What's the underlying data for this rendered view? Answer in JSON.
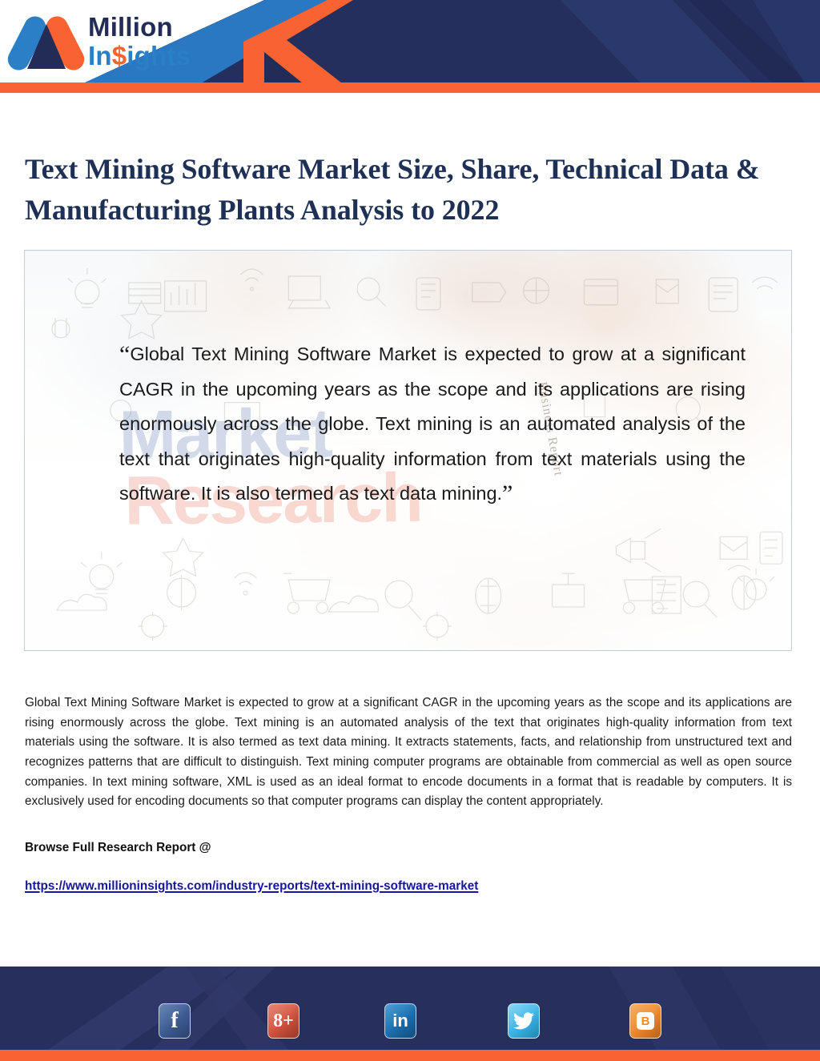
{
  "brand": {
    "logo_line1": "Million",
    "logo_line2_pre": "In",
    "logo_line2_dollar": "$",
    "logo_line2_post": "ights",
    "accent_orange": "#f96331",
    "accent_navy": "#222c56",
    "accent_blue": "#2a7fc6"
  },
  "title": "Text Mining Software Market Size, Share, Technical Data & Manufacturing Plants Analysis to 2022",
  "quote": {
    "open_mark": "“",
    "text": "Global Text Mining Software Market is expected to grow at a significant CAGR in the upcoming years as the scope and its applications are rising enormously across the globe. Text mining is an automated analysis of the text that originates high-quality information from text materials using the software. It is also termed as text data mining.",
    "close_mark": "”",
    "watermark_line1": "Market",
    "watermark_line2": "Research",
    "watermark_small": "Business Report"
  },
  "body": {
    "paragraph": "Global Text Mining Software Market is expected to grow at a significant CAGR in the upcoming years as the scope and its applications are rising enormously across the globe. Text mining is an automated analysis of the text that originates high-quality information from text materials using the software. It is also termed as text data mining. It extracts statements, facts, and relationship from unstructured text and recognizes patterns that are difficult to distinguish. Text mining computer programs are obtainable from commercial as well as open source companies. In text mining software, XML is used as an ideal format to encode documents in a format that is readable by computers. It is exclusively used for encoding documents so that computer programs can display the content appropriately.",
    "browse_label": "Browse Full Research Report @",
    "report_url": "https://www.millioninsights.com/industry-reports/text-mining-software-market"
  },
  "footer": {
    "social": [
      {
        "name": "facebook",
        "glyph": "f"
      },
      {
        "name": "google-plus",
        "glyph": "8+"
      },
      {
        "name": "linkedin",
        "glyph": "in"
      },
      {
        "name": "twitter",
        "glyph": ""
      },
      {
        "name": "blogger",
        "glyph": "B"
      }
    ]
  }
}
